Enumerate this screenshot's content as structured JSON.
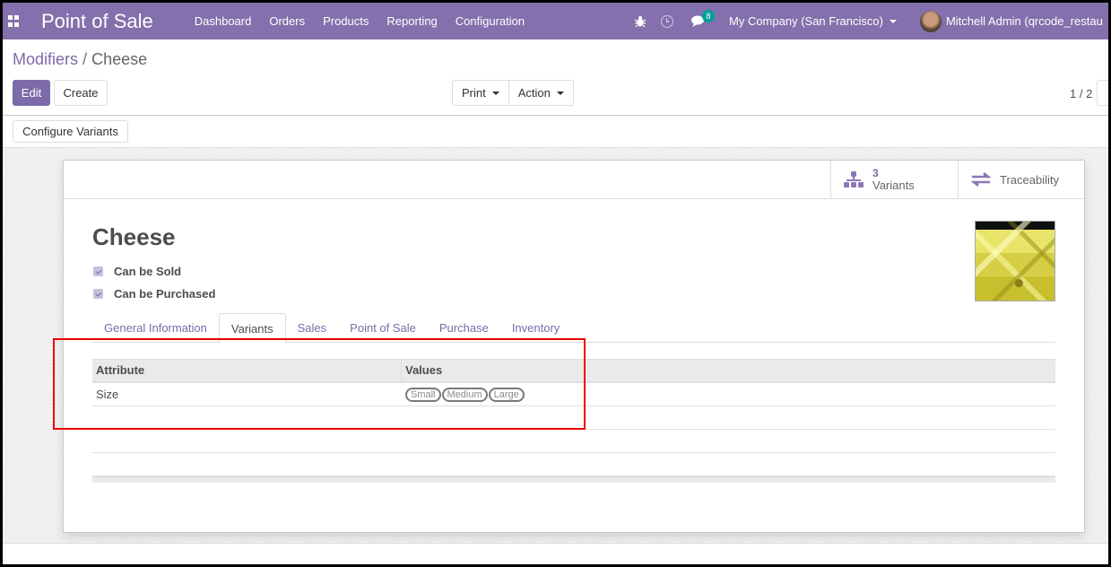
{
  "navbar": {
    "app_name": "Point of Sale",
    "menu": [
      "Dashboard",
      "Orders",
      "Products",
      "Reporting",
      "Configuration"
    ],
    "messages_count": "8",
    "company": "My Company (San Francisco)",
    "user": "Mitchell Admin (qrcode_restau",
    "brand_color": "#8370ac"
  },
  "breadcrumb": {
    "parent": "Modifiers",
    "separator": "/",
    "current": "Cheese"
  },
  "toolbar": {
    "edit_label": "Edit",
    "create_label": "Create",
    "print_label": "Print",
    "action_label": "Action",
    "pager": "1 / 2",
    "configure_variants_label": "Configure Variants"
  },
  "smart_buttons": {
    "variants_count": "3",
    "variants_label": "Variants",
    "traceability_label": "Traceability"
  },
  "product": {
    "name": "Cheese",
    "can_be_sold_label": "Can be Sold",
    "can_be_sold": true,
    "can_be_purchased_label": "Can be Purchased",
    "can_be_purchased": true,
    "image": "cheese-cubes-photo"
  },
  "tabs": [
    {
      "label": "General Information",
      "active": false
    },
    {
      "label": "Variants",
      "active": true
    },
    {
      "label": "Sales",
      "active": false
    },
    {
      "label": "Point of Sale",
      "active": false
    },
    {
      "label": "Purchase",
      "active": false
    },
    {
      "label": "Inventory",
      "active": false
    }
  ],
  "attributes_table": {
    "columns": [
      "Attribute",
      "Values"
    ],
    "rows": [
      {
        "attribute": "Size",
        "values": [
          "Small",
          "Medium",
          "Large"
        ]
      }
    ]
  }
}
